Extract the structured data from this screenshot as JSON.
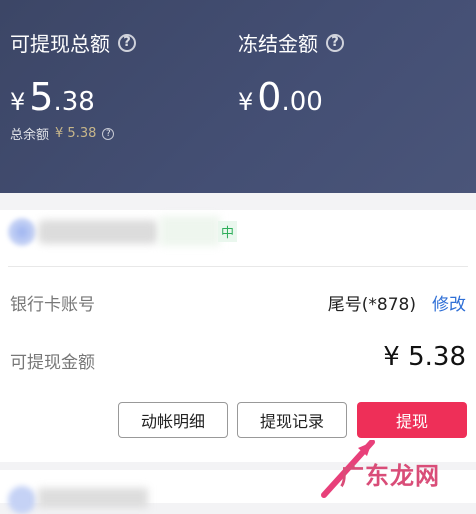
{
  "balance": {
    "withdrawable_label": "可提现总额",
    "withdrawable_yen": "¥",
    "withdrawable_int": "5",
    "withdrawable_dec": ".38",
    "frozen_label": "冻结金额",
    "frozen_yen": "¥",
    "frozen_int": "0",
    "frozen_dec": ".00",
    "total_label": "总余额",
    "total_value": "¥ 5.38"
  },
  "bank": {
    "tag": "中",
    "account_label": "银行卡账号",
    "account_tail": "尾号(*878)",
    "edit_label": "修改"
  },
  "withdraw": {
    "amount_label": "可提现金额",
    "amount_value": "¥ 5.38"
  },
  "buttons": {
    "details": "动帐明细",
    "records": "提现记录",
    "withdraw": "提现"
  },
  "watermark": "广东龙网",
  "colors": {
    "header_bg": "#444f74",
    "primary": "#ee2f58",
    "link": "#2f6fd6",
    "tag_green": "#2fae5b",
    "gold": "#c7b68a"
  }
}
